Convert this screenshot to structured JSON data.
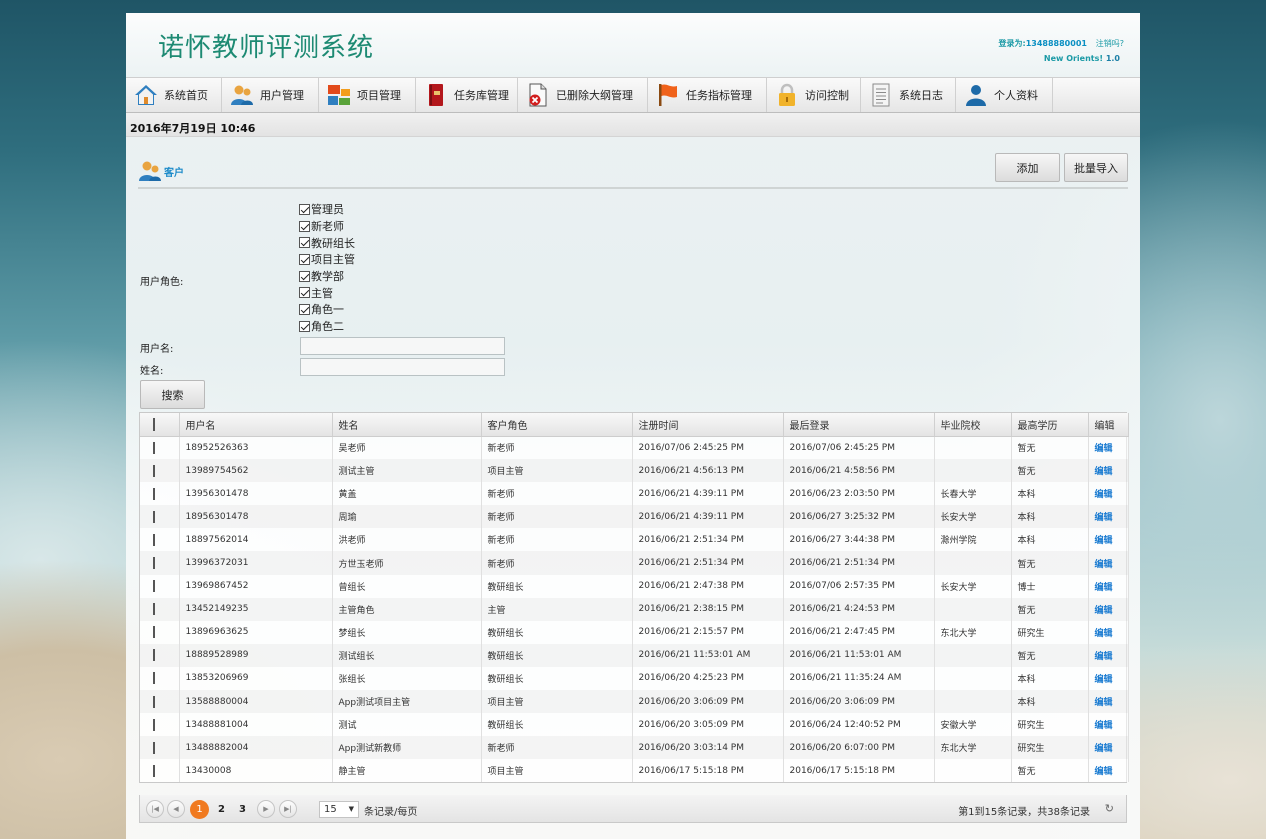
{
  "app": {
    "title": "诺怀教师评测系统",
    "login_prefix": "登录为:",
    "login_user": "13488880001",
    "logout": "注销吗?",
    "version_name": "New Orients! ",
    "version_num": "1.0"
  },
  "nav": [
    {
      "label": "系统首页",
      "icon": "home-icon"
    },
    {
      "label": "用户管理",
      "icon": "users-icon"
    },
    {
      "label": "项目管理",
      "icon": "project-icon"
    },
    {
      "label": "任务库管理",
      "icon": "book-icon"
    },
    {
      "label": "已删除大纲管理",
      "icon": "deleted-doc-icon"
    },
    {
      "label": "任务指标管理",
      "icon": "flag-icon"
    },
    {
      "label": "访问控制",
      "icon": "lock-icon"
    },
    {
      "label": "系统日志",
      "icon": "log-icon"
    },
    {
      "label": "个人资料",
      "icon": "profile-icon"
    }
  ],
  "datetime": "2016年7月19日 10:46",
  "section": {
    "title": "客户",
    "add_button": "添加",
    "import_button": "批量导入"
  },
  "filters": {
    "role_label": "用户角色:",
    "roles": [
      "管理员",
      "新老师",
      "教研组长",
      "项目主管",
      "教学部",
      "主管",
      "角色一",
      "角色二"
    ],
    "username_label": "用户名:",
    "name_label": "姓名:",
    "username_value": "",
    "name_value": "",
    "search_button": "搜索"
  },
  "table": {
    "headers": [
      "用户名",
      "姓名",
      "客户角色",
      "注册时间",
      "最后登录",
      "毕业院校",
      "最高学历",
      "编辑"
    ],
    "edit_label": "编辑",
    "rows": [
      [
        "18952526363",
        "吴老师",
        "新老师",
        "2016/07/06 2:45:25 PM",
        "2016/07/06 2:45:25 PM",
        "",
        "暂无"
      ],
      [
        "13989754562",
        "测试主管",
        "项目主管",
        "2016/06/21 4:56:13 PM",
        "2016/06/21 4:58:56 PM",
        "",
        "暂无"
      ],
      [
        "13956301478",
        "黄盖",
        "新老师",
        "2016/06/21 4:39:11 PM",
        "2016/06/23 2:03:50 PM",
        "长春大学",
        "本科"
      ],
      [
        "18956301478",
        "周瑜",
        "新老师",
        "2016/06/21 4:39:11 PM",
        "2016/06/27 3:25:32 PM",
        "长安大学",
        "本科"
      ],
      [
        "18897562014",
        "洪老师",
        "新老师",
        "2016/06/21 2:51:34 PM",
        "2016/06/27 3:44:38 PM",
        "滁州学院",
        "本科"
      ],
      [
        "13996372031",
        "方世玉老师",
        "新老师",
        "2016/06/21 2:51:34 PM",
        "2016/06/21 2:51:34 PM",
        "",
        "暂无"
      ],
      [
        "13969867452",
        "曾组长",
        "教研组长",
        "2016/06/21 2:47:38 PM",
        "2016/07/06 2:57:35 PM",
        "长安大学",
        "博士"
      ],
      [
        "13452149235",
        "主管角色",
        "主管",
        "2016/06/21 2:38:15 PM",
        "2016/06/21 4:24:53 PM",
        "",
        "暂无"
      ],
      [
        "13896963625",
        "梦组长",
        "教研组长",
        "2016/06/21 2:15:57 PM",
        "2016/06/21 2:47:45 PM",
        "东北大学",
        "研究生"
      ],
      [
        "18889528989",
        "测试组长",
        "教研组长",
        "2016/06/21 11:53:01 AM",
        "2016/06/21 11:53:01 AM",
        "",
        "暂无"
      ],
      [
        "13853206969",
        "张组长",
        "教研组长",
        "2016/06/20 4:25:23 PM",
        "2016/06/21 11:35:24 AM",
        "",
        "本科"
      ],
      [
        "13588880004",
        "App测试项目主管",
        "项目主管",
        "2016/06/20 3:06:09 PM",
        "2016/06/20 3:06:09 PM",
        "",
        "本科"
      ],
      [
        "13488881004",
        "测试",
        "教研组长",
        "2016/06/20 3:05:09 PM",
        "2016/06/24 12:40:52 PM",
        "安徽大学",
        "研究生"
      ],
      [
        "13488882004",
        "App测试新教师",
        "新老师",
        "2016/06/20 3:03:14 PM",
        "2016/06/20 6:07:00 PM",
        "东北大学",
        "研究生"
      ],
      [
        "13430008",
        "静主管",
        "项目主管",
        "2016/06/17 5:15:18 PM",
        "2016/06/17 5:15:18 PM",
        "",
        "暂无"
      ]
    ]
  },
  "pager": {
    "pages": [
      "1",
      "2",
      "3"
    ],
    "current": "1",
    "page_size": "15",
    "per_page_label": "条记录/每页",
    "summary": "第1到15条记录，共38条记录"
  }
}
